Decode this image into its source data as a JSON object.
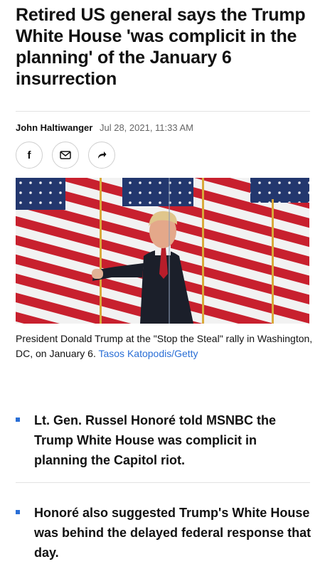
{
  "article": {
    "headline": "Retired US general says the Trump White House 'was complicit in the planning' of the January 6 insurrection",
    "author": "John Haltiwanger",
    "date": "Jul 28, 2021, 11:33 AM"
  },
  "share": [
    {
      "name": "facebook-share-icon",
      "glyph": "f"
    },
    {
      "name": "email-share-icon",
      "glyph": "mail"
    },
    {
      "name": "share-icon",
      "glyph": "arrow"
    }
  ],
  "photo": {
    "caption": "President Donald Trump at the \"Stop the Steal\" rally in Washington, DC, on January 6.",
    "credit": "Tasos Katopodis/Getty"
  },
  "bullets": [
    "Lt. Gen. Russel Honoré told MSNBC the Trump White House was complicit in planning the Capitol riot.",
    "Honoré also suggested Trump's White House was behind the delayed federal response that day."
  ],
  "colors": {
    "accent": "#2a6fd6",
    "text": "#111111",
    "muted": "#666666"
  }
}
